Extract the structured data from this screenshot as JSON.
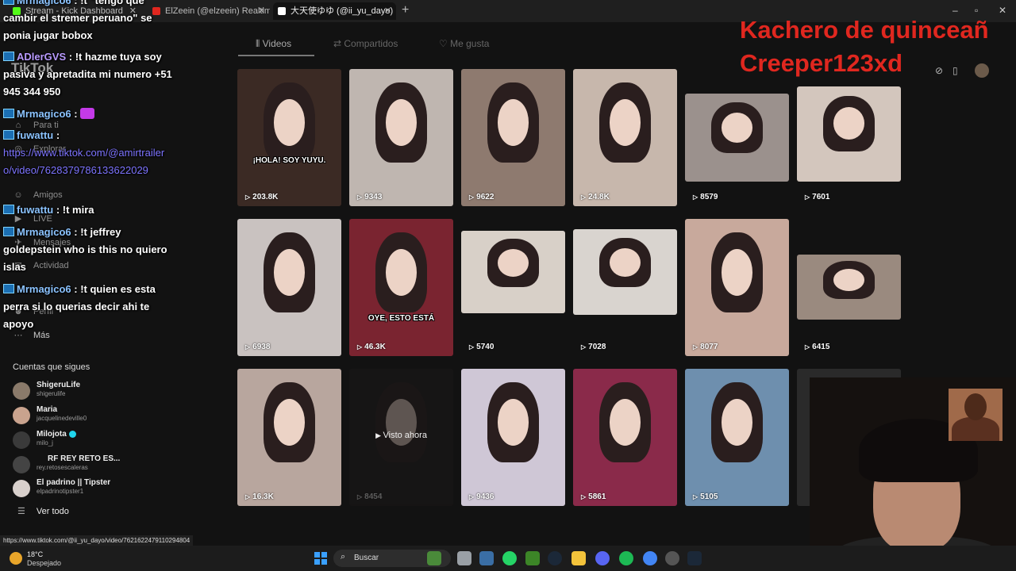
{
  "browser": {
    "tabs": [
      {
        "label": "Stream - Kick Dashboard",
        "color": "#53fc18"
      },
      {
        "label": "ElZeein (@elzeein) Realtime Kick",
        "color": "#e0271f"
      },
      {
        "label": "大天使ゆゆ (@ii_yu_dayo) |",
        "color": "#ffffff"
      }
    ],
    "new_tab": "+",
    "window_controls": [
      "–",
      "▫",
      "✕"
    ]
  },
  "tiktok": {
    "logo": "TikTok",
    "nav": [
      {
        "label": "Para ti",
        "icon": "home-icon",
        "glyph": "⌂"
      },
      {
        "label": "Explorar",
        "icon": "compass-icon",
        "glyph": "◎"
      },
      {
        "label": "Amigos",
        "icon": "friends-icon",
        "glyph": "☺"
      },
      {
        "label": "LIVE",
        "icon": "live-icon",
        "glyph": "▶"
      },
      {
        "label": "Mensajes",
        "icon": "messages-icon",
        "glyph": "✈"
      },
      {
        "label": "Actividad",
        "icon": "activity-icon",
        "glyph": "✉"
      },
      {
        "label": "Perfil",
        "icon": "profile-icon",
        "glyph": "☻"
      },
      {
        "label": "Más",
        "icon": "more-icon",
        "glyph": "⋯"
      }
    ],
    "following_title": "Cuentas que sigues",
    "following": [
      {
        "name": "ShigeruLife",
        "handle": "shigerulife",
        "verified": false
      },
      {
        "name": "Maria",
        "handle": "jacquelinedeville0",
        "verified": false
      },
      {
        "name": "Milojota",
        "handle": "milo_j",
        "verified": true
      },
      {
        "name": "RF REY RETO ES...",
        "handle": "rey.retosescaleras",
        "verified": false
      },
      {
        "name": "El padrino || Tipster",
        "handle": "elpadrinotipster1",
        "verified": false
      }
    ],
    "see_all": "Ver todo",
    "profile_tabs": [
      "Videos",
      "Compartidos",
      "Me gusta"
    ],
    "videos": [
      {
        "views": "203.8K",
        "caption": "¡HOLA! SOY YUYU."
      },
      {
        "views": "9343",
        "caption": ""
      },
      {
        "views": "9622",
        "caption": ""
      },
      {
        "views": "24.8K",
        "caption": ""
      },
      {
        "views": "8579",
        "caption": ""
      },
      {
        "views": "7601",
        "caption": ""
      },
      {
        "views": "6938",
        "caption": ""
      },
      {
        "views": "46.3K",
        "caption": "OYE, ESTO ESTÁ"
      },
      {
        "views": "5740",
        "caption": ""
      },
      {
        "views": "7028",
        "caption": ""
      },
      {
        "views": "8077",
        "caption": ""
      },
      {
        "views": "6415",
        "caption": ""
      },
      {
        "views": "16.3K",
        "caption": ""
      },
      {
        "views": "8454",
        "caption": "",
        "watched": "Visto ahora"
      },
      {
        "views": "9436",
        "caption": ""
      },
      {
        "views": "5861",
        "caption": ""
      },
      {
        "views": "5105",
        "caption": ""
      },
      {
        "views": "",
        "caption": ""
      }
    ]
  },
  "chat": [
    {
      "user": "Mrmagico6",
      "text": " : !t \"tengo que cambir el stremer peruano\" se ponia jugar bobox"
    },
    {
      "user": "ADlerGVS",
      "text": " : !t hazme tuya soy pasiva y apretadita mi numero +51 945 344 950"
    },
    {
      "user": "Mrmagico6",
      "text": " : ",
      "emote": true
    },
    {
      "user": "fuwattu",
      "text": " : "
    },
    {
      "link": "https://www.tiktok.com/@amirtrailero/video/7628379786133622029"
    },
    {
      "user": "fuwattu",
      "text": " : !t mira"
    },
    {
      "user": "Mrmagico6",
      "text": " : !t jeffrey goldepstein who is this no quiero islas"
    },
    {
      "user": "Mrmagico6",
      "text": " : !t quien es esta perra si lo querias decir ahi te apoyo"
    }
  ],
  "overlay": {
    "line1": "Kachero de quinceañ",
    "line2": "Creeper123xd"
  },
  "status_url": "https://www.tiktok.com/@ii_yu_dayo/video/7621622479110294804",
  "taskbar": {
    "temperature": "18°C",
    "condition": "Despejado",
    "search_label": "Buscar"
  }
}
